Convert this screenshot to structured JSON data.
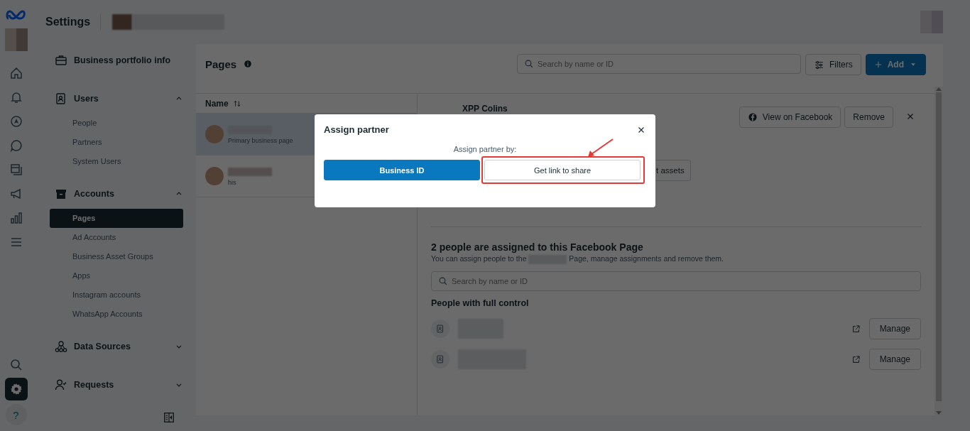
{
  "rail": {
    "items": [
      {
        "selected": false
      },
      {
        "selected": false
      },
      {
        "selected": false
      },
      {
        "selected": false
      },
      {
        "selected": false
      },
      {
        "selected": false
      },
      {
        "selected": false
      },
      {
        "selected": false
      }
    ],
    "bottom": [
      {
        "selected": false
      },
      {
        "selected": true
      }
    ],
    "help_label": "?"
  },
  "header": {
    "title": "Settings"
  },
  "sidebar": {
    "sections": [
      {
        "label": "Business portfolio info"
      },
      {
        "label": "Users",
        "expanded": true,
        "children": [
          {
            "label": "People",
            "selected": false
          },
          {
            "label": "Partners",
            "selected": false
          },
          {
            "label": "System Users",
            "selected": false
          }
        ]
      },
      {
        "label": "Accounts",
        "expanded": true,
        "children": [
          {
            "label": "Pages",
            "selected": true
          },
          {
            "label": "Ad Accounts",
            "selected": false
          },
          {
            "label": "Business Asset Groups",
            "selected": false
          },
          {
            "label": "Apps",
            "selected": false
          },
          {
            "label": "Instagram accounts",
            "selected": false
          },
          {
            "label": "WhatsApp Accounts",
            "selected": false
          }
        ]
      },
      {
        "label": "Data Sources",
        "expanded": false
      },
      {
        "label": "Requests",
        "expanded": false
      }
    ]
  },
  "main": {
    "title": "Pages",
    "search": {
      "placeholder": "Search by name or ID"
    },
    "filters_label": "Filters",
    "add_label": "Add",
    "list": {
      "column": "Name",
      "rows": [
        {
          "subtitle": "Primary business page",
          "selected": true
        },
        {
          "subtitle": "his",
          "selected": false
        }
      ]
    },
    "detail": {
      "page_name": "XPP Colins",
      "buttons": [
        "View on Facebook",
        "Remove"
      ],
      "partial_button": "t assets",
      "heading": "2 people are assigned to this Facebook Page",
      "description_before": "You can assign people to the ",
      "description_after": " Page, manage assignments and remove them.",
      "search": {
        "placeholder": "Search by name or ID"
      },
      "group_title": "People with full control",
      "people": [
        {
          "action": "Manage"
        },
        {
          "action": "Manage"
        }
      ]
    }
  },
  "dialog": {
    "title": "Assign partner",
    "prompt": "Assign partner by:",
    "options": [
      {
        "label": "Business ID",
        "kind": "primary",
        "highlighted": false
      },
      {
        "label": "Get link to share",
        "kind": "secondary",
        "highlighted": true
      }
    ]
  }
}
